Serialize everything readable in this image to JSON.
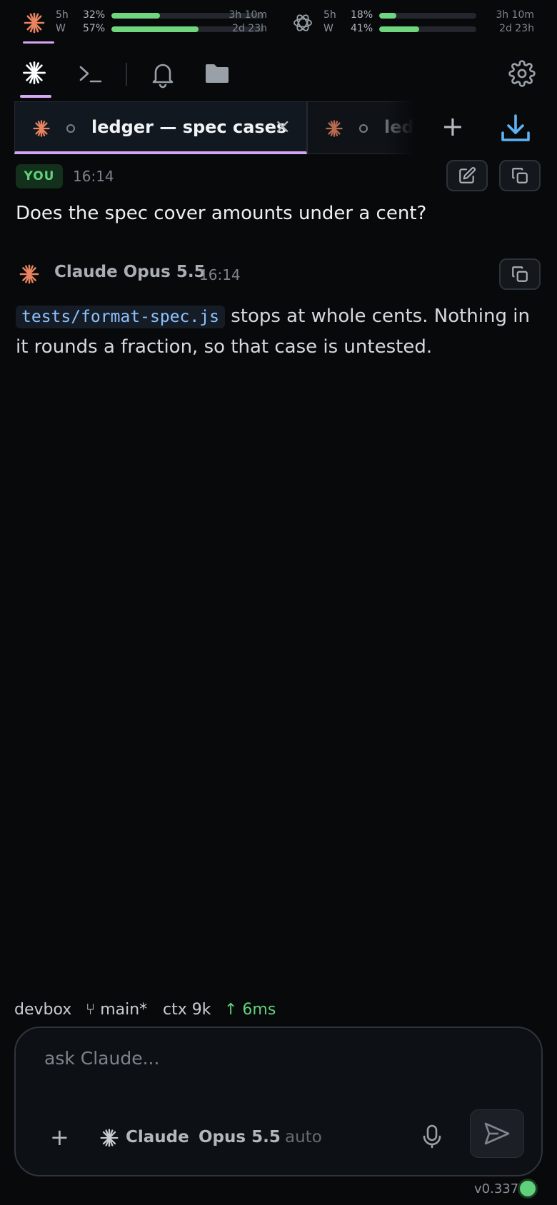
{
  "usage": {
    "claude": {
      "rows": [
        {
          "label": "5h",
          "pct": "32%",
          "fill": 0.32,
          "time": "3h 10m"
        },
        {
          "label": "W",
          "pct": "57%",
          "fill": 0.57,
          "time": "2d 23h"
        }
      ]
    },
    "openai": {
      "rows": [
        {
          "label": "5h",
          "pct": "18%",
          "fill": 0.18,
          "time": "3h 10m"
        },
        {
          "label": "W",
          "pct": "41%",
          "fill": 0.41,
          "time": "2d 23h"
        }
      ]
    }
  },
  "tabs": [
    {
      "title": "ledger — spec cases",
      "close": "×"
    },
    {
      "title": "ledger"
    }
  ],
  "tab_add": "+",
  "conversation": {
    "user": {
      "badge": "YOU",
      "time": "16:14",
      "text": "Does the spec cover amounts under a cent?"
    },
    "assistant": {
      "name": "Claude Opus 5.5",
      "time": "16:14",
      "code": "tests/format-spec.js",
      "text": " stops at whole cents. Nothing in it rounds a fraction, so that case is untested."
    }
  },
  "status": {
    "host": "devbox",
    "branch": "⑂ main*",
    "ctx": "ctx 9k",
    "latency": "↑ 6ms"
  },
  "composer": {
    "placeholder": "ask Claude...",
    "add": "+",
    "agent": "Claude",
    "model": "Opus 5.5",
    "mode": "auto"
  },
  "version": "v0.337",
  "colors": {
    "accent": "#d7a6f2",
    "claude_orange": "#e8845f",
    "green": "#63d17a",
    "code_blue": "#8cc2ff",
    "download_blue": "#5fb3f5"
  }
}
